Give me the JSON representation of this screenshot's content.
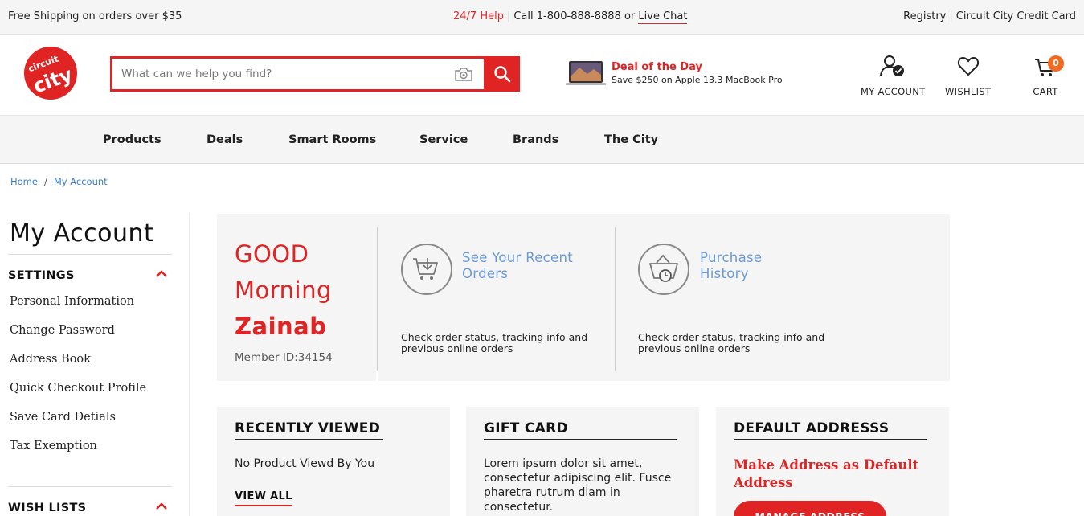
{
  "topbar": {
    "shipping": "Free Shipping on orders over $35",
    "help": "24/7 Help",
    "call": "Call 1-800-888-8888 or",
    "live_chat": "Live Chat",
    "registry": "Registry",
    "credit_card": "Circuit City Credit Card"
  },
  "header": {
    "logo_text": "circuit city",
    "search_placeholder": "What can we help you find?",
    "deal_title": "Deal of the Day",
    "deal_text": "Save $250 on Apple 13.3 MacBook Pro",
    "account_label": "MY ACCOUNT",
    "wishlist_label": "WISHLIST",
    "cart_label": "CART",
    "cart_count": "0"
  },
  "nav": {
    "items": [
      "Products",
      "Deals",
      "Smart Rooms",
      "Service",
      "Brands",
      "The City"
    ]
  },
  "breadcrumb": {
    "home": "Home",
    "current": "My Account"
  },
  "sidebar": {
    "title": "My Account",
    "settings_heading": "SETTINGS",
    "links": [
      "Personal Information",
      "Change Password",
      "Address Book",
      "Quick Checkout Profile",
      "Save Card Detials",
      "Tax Exemption"
    ],
    "wishlists_heading": "WISH LISTS"
  },
  "welcome": {
    "greeting_line1": "GOOD",
    "greeting_line2": "Morning",
    "name": "Zainab",
    "member_id": "Member ID:34154",
    "orders_link_line1": "See Your Recent",
    "orders_link_line2": "Orders",
    "orders_desc": "Check order status, tracking info and previous online orders",
    "history_link_line1": "Purchase",
    "history_link_line2": "History",
    "history_desc": "Check order status, tracking info and previous online orders"
  },
  "cards": {
    "recent": {
      "title": "RECENTLY VIEWED",
      "body": "No Product Viewd By You",
      "view_all": "VIEW ALL"
    },
    "gift": {
      "title": "GIFT CARD",
      "body": "Lorem ipsum dolor sit amet, consectetur adipiscing elit. Fusce pharetra rutrum diam in consectetur."
    },
    "address": {
      "title": "DEFAULT ADDRESSS",
      "make_default": "Make Address as Default Address",
      "manage": "MANAGE ADDRESS"
    }
  },
  "colors": {
    "brand_red": "#e02424",
    "link_blue": "#6b9bd6",
    "badge_orange": "#f26a21",
    "panel_gray": "#f5f5f6"
  }
}
